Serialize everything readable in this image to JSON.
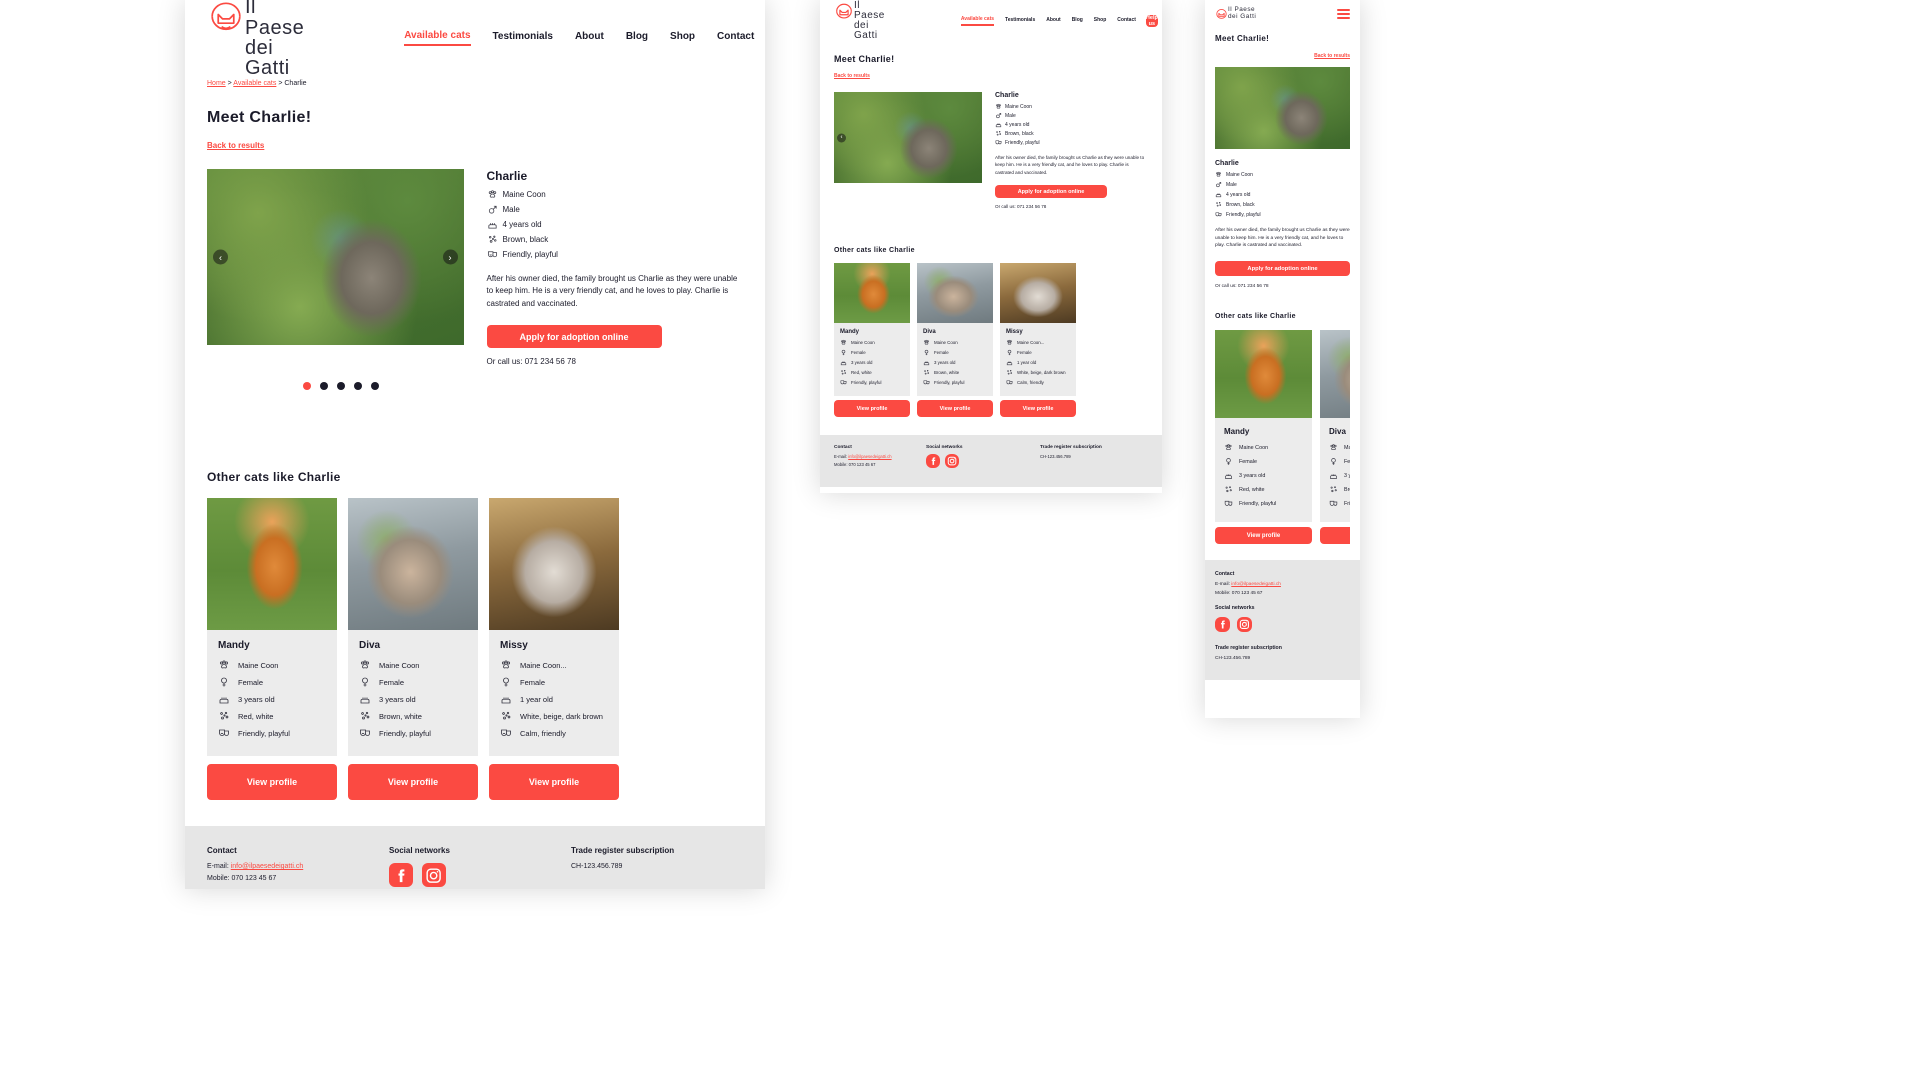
{
  "brand": {
    "name_line1": "Il Paese",
    "name_line2": "dei Gatti",
    "accent_color": "#fb4a42",
    "text_color": "#1b1b2a"
  },
  "nav": {
    "items": [
      {
        "label": "Available cats",
        "active": true
      },
      {
        "label": "Testimonials",
        "active": false
      },
      {
        "label": "About",
        "active": false
      },
      {
        "label": "Blog",
        "active": false
      },
      {
        "label": "Shop",
        "active": false
      },
      {
        "label": "Contact",
        "active": false
      }
    ],
    "cta_label": "Help us",
    "menu_icon": "hamburger-icon"
  },
  "breadcrumb": {
    "home": "Home",
    "sep1": ">",
    "available": "Available cats",
    "sep2": ">",
    "current": "Charlie",
    "full": "Home > Available cats > Charlie"
  },
  "page": {
    "title": "Meet Charlie!",
    "back_label": "Back to results",
    "gallery": {
      "prev_icon": "chevron-left-icon",
      "next_icon": "chevron-right-icon",
      "dots_total": 5,
      "dot_active_index": 0,
      "image_alt": "charlie-photo"
    },
    "cat": {
      "name": "Charlie",
      "specs": [
        {
          "icon": "paw-icon",
          "text": "Maine Coon"
        },
        {
          "icon": "gender-male-icon",
          "text": "Male"
        },
        {
          "icon": "birthday-cake-icon",
          "text": "4 years old"
        },
        {
          "icon": "palette-icon",
          "text": "Brown, black"
        },
        {
          "icon": "theater-masks-icon",
          "text": "Friendly, playful"
        }
      ],
      "bio": "After his owner died, the family brought us Charlie as they were unable to keep him. He is a very friendly cat, and he loves to play. Charlie is castrated and vaccinated.",
      "apply_label": "Apply for adoption online",
      "call_text": "Or call us: 071 234 56 78"
    },
    "related_title": "Other cats like Charlie",
    "view_profile_label": "View profile",
    "related": [
      {
        "name": "Mandy",
        "photo": "mandy",
        "specs": [
          {
            "icon": "paw-icon",
            "text": "Maine Coon"
          },
          {
            "icon": "gender-female-icon",
            "text": "Female"
          },
          {
            "icon": "birthday-cake-icon",
            "text": "3 years old"
          },
          {
            "icon": "palette-icon",
            "text": "Red, white"
          },
          {
            "icon": "theater-masks-icon",
            "text": "Friendly, playful"
          }
        ]
      },
      {
        "name": "Diva",
        "photo": "diva",
        "specs": [
          {
            "icon": "paw-icon",
            "text": "Maine Coon"
          },
          {
            "icon": "gender-female-icon",
            "text": "Female"
          },
          {
            "icon": "birthday-cake-icon",
            "text": "3 years old"
          },
          {
            "icon": "palette-icon",
            "text": "Brown, white"
          },
          {
            "icon": "theater-masks-icon",
            "text": "Friendly, playful"
          }
        ]
      },
      {
        "name": "Missy",
        "photo": "missy",
        "specs": [
          {
            "icon": "paw-icon",
            "text": "Maine Coon..."
          },
          {
            "icon": "gender-female-icon",
            "text": "Female"
          },
          {
            "icon": "birthday-cake-icon",
            "text": "1 year old"
          },
          {
            "icon": "palette-icon",
            "text": "White, beige, dark brown"
          },
          {
            "icon": "theater-masks-icon",
            "text": "Calm, friendly"
          }
        ]
      }
    ]
  },
  "footer": {
    "contact_title": "Contact",
    "email_label": "E-mail:",
    "email": "info@ilpaesedeigatti.ch",
    "mobile": "Mobile: 070 123 45 67",
    "social_title": "Social networks",
    "social": [
      {
        "icon": "facebook-icon",
        "name": "Facebook"
      },
      {
        "icon": "instagram-icon",
        "name": "Instagram"
      }
    ],
    "register_title": "Trade register subscription",
    "register_number": "CH-123.456.789"
  }
}
